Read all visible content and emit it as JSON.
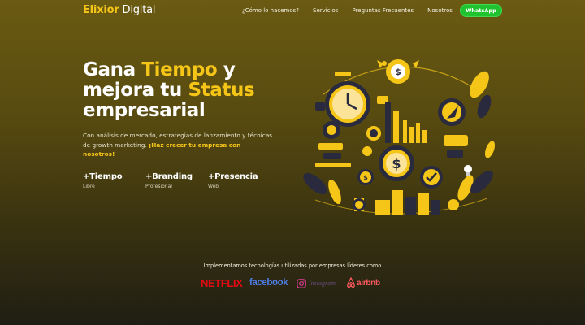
{
  "brand": {
    "part1": "Elixior",
    "part2": " Digital"
  },
  "nav": {
    "links": [
      "¿Cómo lo hacemos?",
      "Servicios",
      "Preguntas Frecuentes",
      "Nosotros"
    ],
    "cta": "WhatsApp"
  },
  "hero": {
    "line1_a": "Gana ",
    "line1_b": "Tiempo",
    "line1_c": " y",
    "line2_a": "mejora tu ",
    "line2_b": "Status",
    "line3": "empresarial",
    "desc": "Con análisis de mercado, estrategias de lanzamiento y técnicas de growth marketing. ",
    "desc_strong": "¡Haz crecer tu empresa con nosotros!"
  },
  "stats": [
    {
      "title": "+Tiempo",
      "sub": "Libre"
    },
    {
      "title": "+Branding",
      "sub": "Profesional"
    },
    {
      "title": "+Presencia",
      "sub": "Web"
    }
  ],
  "tech": {
    "caption": "Implementamos tecnologías utilizadas por empresas líderes como",
    "brands": [
      "NETFLIX",
      "facebook",
      "Instagram",
      "airbnb"
    ]
  },
  "colors": {
    "accent": "#f5c518",
    "whatsapp": "#1fc22f",
    "netflix": "#e50914",
    "facebook": "#4d7de6",
    "airbnb": "#ff5a5f"
  },
  "icons": [
    "clock-icon",
    "dollar-coin-icon",
    "bar-chart-icon",
    "rocket-icon",
    "leaf-icon",
    "checkmark-icon",
    "lightbulb-icon",
    "instagram-icon",
    "airbnb-icon"
  ]
}
